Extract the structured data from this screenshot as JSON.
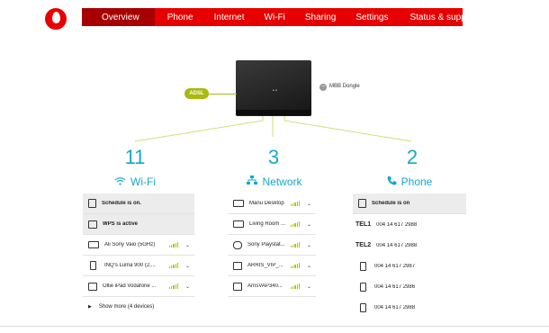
{
  "nav": {
    "items": [
      {
        "label": "Overview"
      },
      {
        "label": "Phone"
      },
      {
        "label": "Internet"
      },
      {
        "label": "Wi-Fi"
      },
      {
        "label": "Sharing"
      },
      {
        "label": "Settings"
      },
      {
        "label": "Status & support"
      }
    ]
  },
  "router": {
    "adsl_label": "ADSL",
    "mbb_label": "MBB Dongle",
    "mbb_status_icon": "minus-icon",
    "led_text": "• •"
  },
  "wifi": {
    "count": "11",
    "title": "Wi-Fi",
    "icon": "wifi-icon",
    "rows": [
      {
        "label": "Schedule is on.",
        "icon": "calendar-icon"
      },
      {
        "label": "WPS is active",
        "icon": "wps-icon"
      }
    ],
    "devices": [
      {
        "label": "Ali Sony Vaio (5GHz)",
        "icon": "laptop-icon"
      },
      {
        "label": "INQ's Luma 900 (2,...",
        "icon": "phone-icon"
      },
      {
        "label": "Ollie iPad Vodafone ...",
        "icon": "tablet-icon"
      }
    ],
    "show_more": "Show more (4 devices)"
  },
  "network": {
    "count": "3",
    "title": "Network",
    "icon": "network-icon",
    "devices": [
      {
        "label": "Manu Desktop",
        "icon": "laptop-icon"
      },
      {
        "label": "Living Room ...",
        "icon": "monitor-icon"
      },
      {
        "label": "Sony Playstat...",
        "icon": "gamepad-icon"
      },
      {
        "label": "ARRIS_VIP_...",
        "icon": "settop-icon"
      },
      {
        "label": "ArrisVAP340...",
        "icon": "settop-icon"
      }
    ]
  },
  "phone": {
    "count": "2",
    "title": "Phone",
    "icon": "phone-handset-icon",
    "schedule": "Schedule is on",
    "lines": [
      {
        "tag": "TEL1",
        "number": "004 14 617 2988"
      },
      {
        "tag": "TEL2",
        "number": "004 14 617 2988"
      },
      {
        "tag": "",
        "number": "004 14 617 2987",
        "icon": "mobile-icon"
      },
      {
        "tag": "",
        "number": "004 14 617 2986",
        "icon": "mobile-icon"
      },
      {
        "tag": "",
        "number": "004 14 617 2988",
        "icon": "mobile-icon"
      }
    ]
  },
  "colors": {
    "brand_red": "#e60000",
    "nav_active": "#a80000",
    "accent_blue": "#17a8c9",
    "signal_green": "#b8c400",
    "adsl_green": "#a9b910"
  }
}
